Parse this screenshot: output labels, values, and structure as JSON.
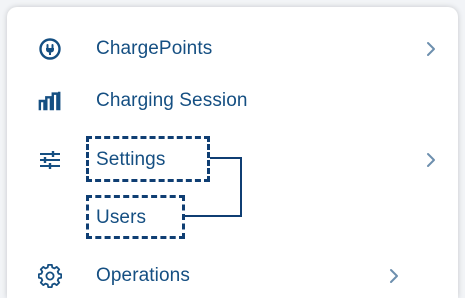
{
  "menu": {
    "items": [
      {
        "label": "ChargePoints",
        "icon": "plug-icon",
        "has_chevron": true
      },
      {
        "label": "Charging Session",
        "icon": "bar-chart-icon",
        "has_chevron": false
      },
      {
        "label": "Settings",
        "icon": "sliders-icon",
        "has_chevron": true,
        "highlighted": true
      },
      {
        "label": "Users",
        "icon": "",
        "has_chevron": false,
        "highlighted": true,
        "submenu": true
      },
      {
        "label": "Operations",
        "icon": "gear-icon",
        "has_chevron": true
      }
    ]
  },
  "colors": {
    "text": "#154f82",
    "icon": "#154f82",
    "chevron": "#6d8fae",
    "callout": "#0f3e73"
  }
}
